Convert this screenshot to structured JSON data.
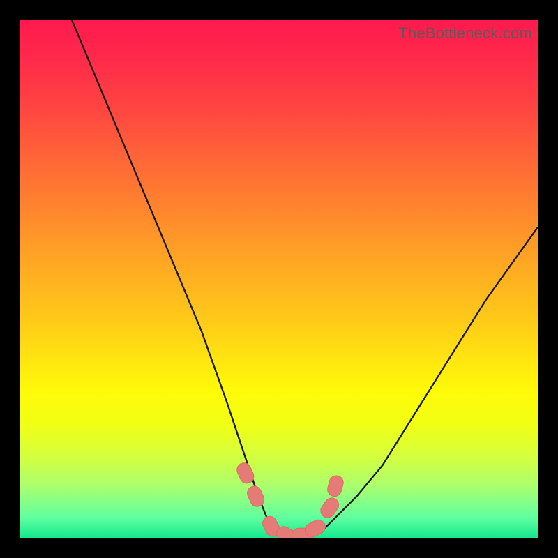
{
  "watermark": "TheBottleneck.com",
  "colors": {
    "background": "#000000",
    "curve": "#1a1a1a",
    "markers": "#e57b77",
    "marker_edge": "#e06a65"
  },
  "chart_data": {
    "type": "line",
    "title": "",
    "xlabel": "",
    "ylabel": "",
    "xlim": [
      0,
      100
    ],
    "ylim": [
      0,
      100
    ],
    "x": [
      10,
      15,
      20,
      25,
      30,
      35,
      40,
      42,
      44,
      46,
      48,
      50,
      52,
      54,
      56,
      58,
      60,
      65,
      70,
      75,
      80,
      85,
      90,
      95,
      100
    ],
    "y": [
      100,
      88,
      76,
      64,
      52,
      40,
      26,
      20,
      14,
      8,
      3,
      1,
      0,
      0,
      0,
      1,
      3,
      8,
      14,
      22,
      30,
      38,
      46,
      53,
      60
    ],
    "markers": {
      "x": [
        43.5,
        45.5,
        48.5,
        51.5,
        54.5,
        57.0,
        59.8,
        60.9
      ],
      "y": [
        12.5,
        8.0,
        2.2,
        0.5,
        0.5,
        1.8,
        5.8,
        10.0
      ]
    },
    "notes": "Bottleneck curve: V-shaped function reaching minimum near x≈53; left branch starts near top-left, right branch exits at ~60% height on right edge. Colored gradient background from red (top) through orange/yellow to green (bottom). Pink/salmon rounded markers cluster at the trough."
  }
}
